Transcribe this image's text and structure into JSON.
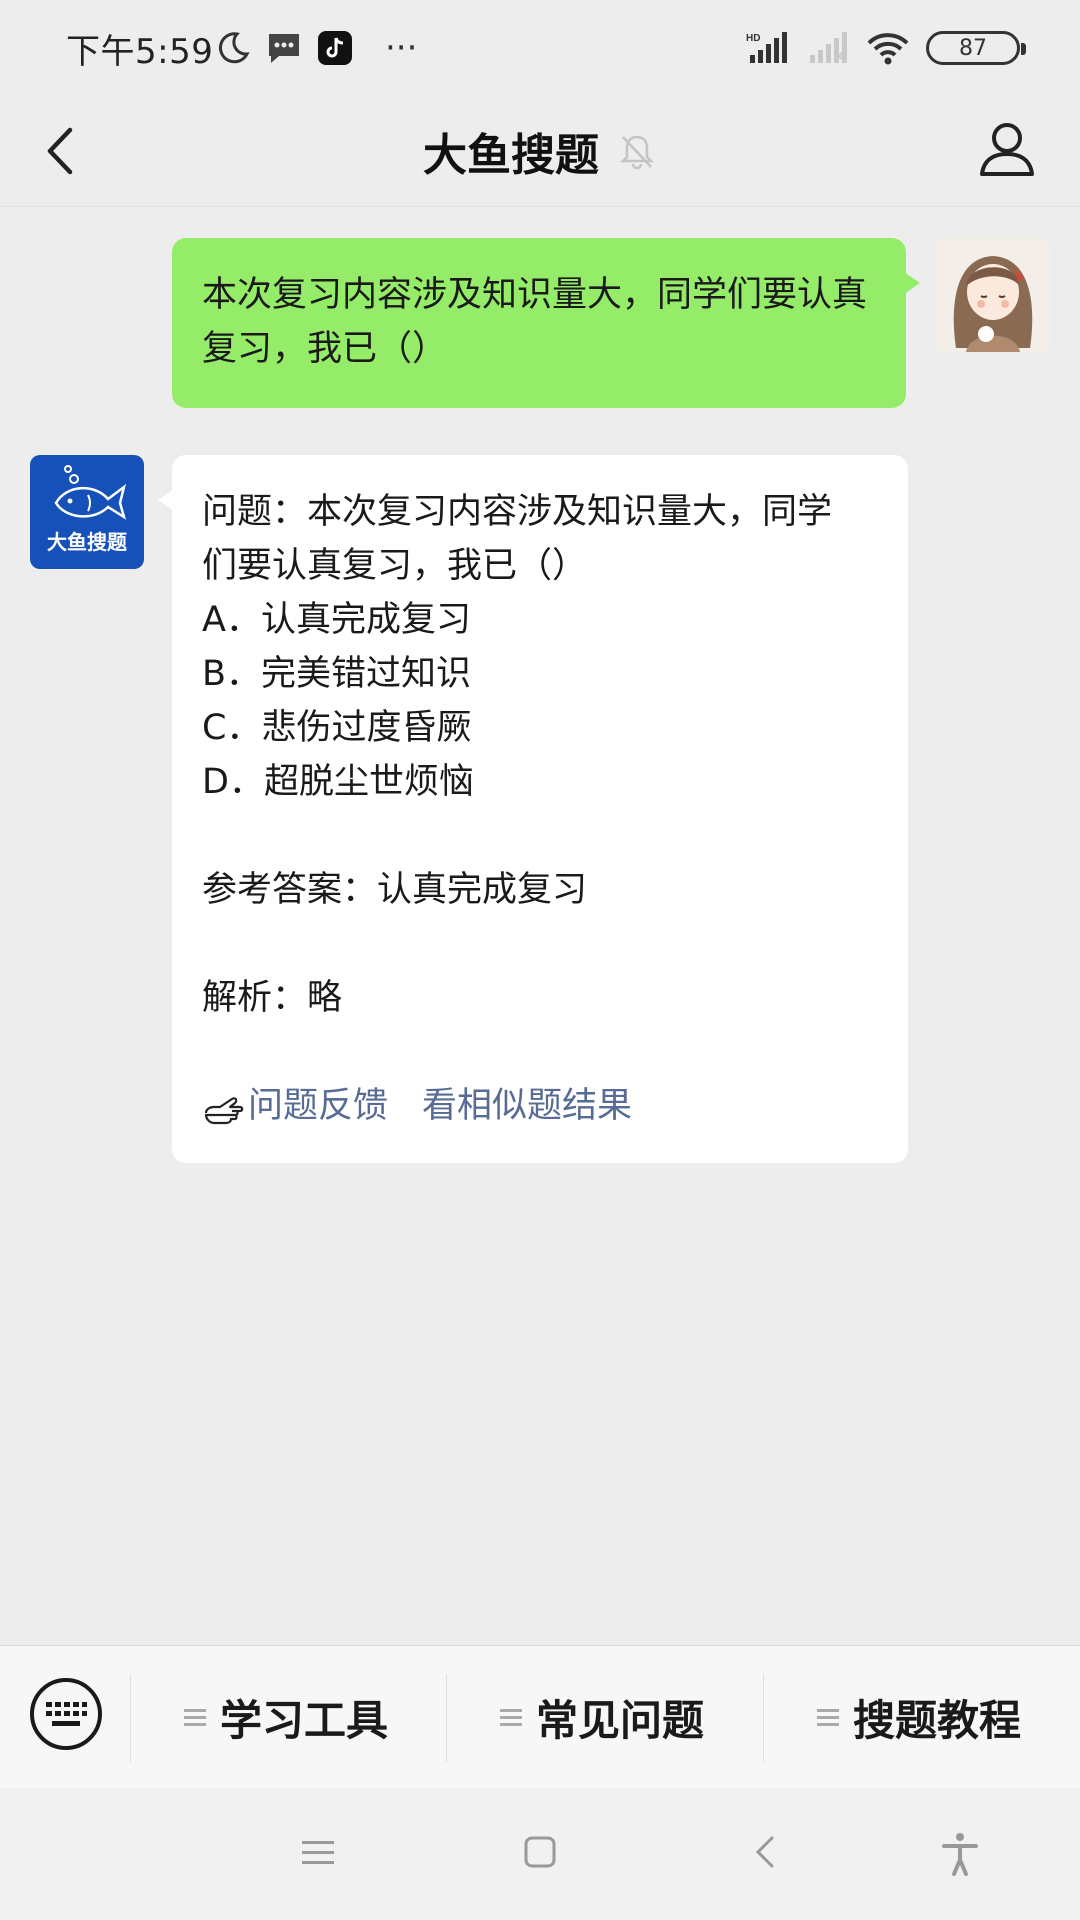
{
  "status_bar": {
    "time": "下午5:59",
    "battery": "87",
    "icons": [
      "moon-icon",
      "message-icon",
      "tiktok-icon",
      "more-icon",
      "hd-signal-icon",
      "signal-icon",
      "wifi-icon",
      "battery-icon"
    ]
  },
  "header": {
    "title": "大鱼搜题",
    "icons": [
      "back-icon",
      "mute-bell-icon",
      "profile-icon"
    ]
  },
  "chat": {
    "user_message": "本次复习内容涉及知识量大，同学们要认真复习，我已（）",
    "bot_avatar_label": "大鱼搜题",
    "bot_reply": {
      "question_line1": "问题：本次复习内容涉及知识量大，同学",
      "question_line2": "们要认真复习，我已（）",
      "options": [
        "A．认真完成复习",
        "B．完美错过知识",
        "C．悲伤过度昏厥",
        "D．超脱尘世烦恼"
      ],
      "answer": "参考答案：认真完成复习",
      "analysis": "解析：略",
      "links": [
        "问题反馈",
        "看相似题结果"
      ]
    }
  },
  "menu": {
    "items": [
      "学习工具",
      "常见问题",
      "搜题教程"
    ]
  },
  "colors": {
    "background": "#ededed",
    "user_bubble": "#95ec69",
    "bot_bubble": "#ffffff",
    "link": "#576b95",
    "bot_avatar": "#1650b9"
  }
}
